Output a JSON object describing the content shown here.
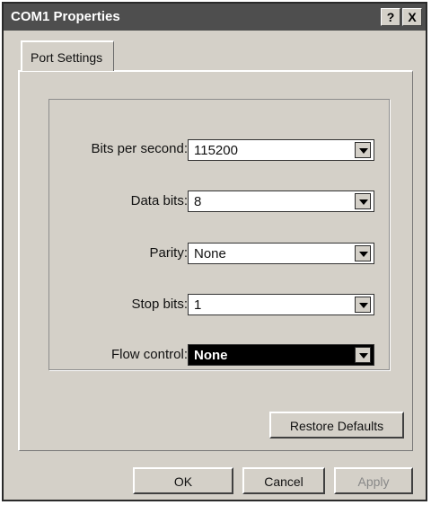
{
  "window": {
    "title": "COM1 Properties",
    "help_label": "?",
    "close_label": "X"
  },
  "tabs": [
    {
      "label": "Port Settings"
    }
  ],
  "settings": {
    "bits_per_second": {
      "label": "Bits per second:",
      "value": "115200"
    },
    "data_bits": {
      "label": "Data bits:",
      "value": "8"
    },
    "parity": {
      "label": "Parity:",
      "value": "None"
    },
    "stop_bits": {
      "label": "Stop bits:",
      "value": "1"
    },
    "flow_control": {
      "label": "Flow control:",
      "value": "None"
    }
  },
  "buttons": {
    "restore_defaults": "Restore Defaults",
    "ok": "OK",
    "cancel": "Cancel",
    "apply": "Apply"
  },
  "colors": {
    "titlebar": "#4e4e4e",
    "face": "#d4d0c8",
    "selection": "#000000"
  }
}
